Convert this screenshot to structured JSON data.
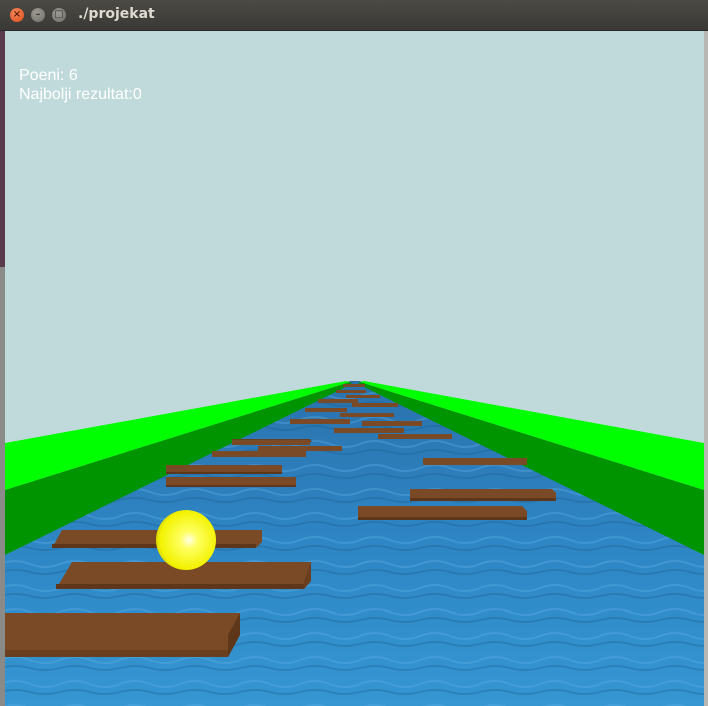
{
  "window": {
    "title": "./projekat",
    "close_glyph": "×",
    "min_glyph": "–",
    "max_glyph": "□"
  },
  "hud": {
    "score_label": "Poeni: 6",
    "best_label": "Najbolji rezultat:0"
  },
  "colors": {
    "sky": "#c0dadb",
    "grass_top": "#00ff00",
    "grass_side": "#009400",
    "water": "#2e86c4",
    "plank": "#7a4a26",
    "ball": "#ffff20"
  }
}
